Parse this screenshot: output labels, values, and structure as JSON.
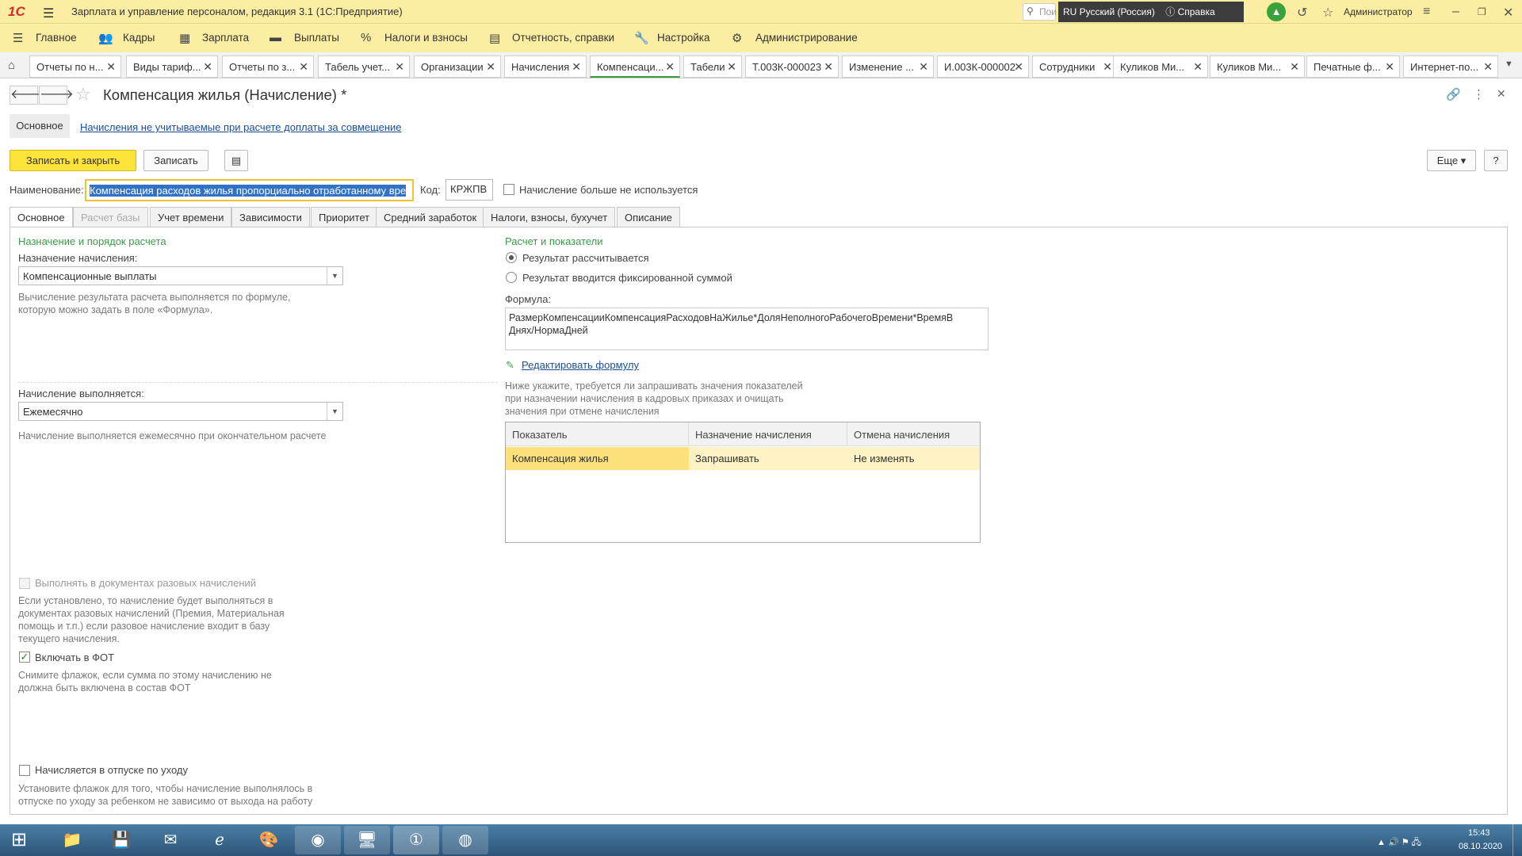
{
  "titlebar": {
    "logo": "1С",
    "title": "Зарплата и управление персоналом, редакция 3.1  (1С:Предприятие)",
    "search_placeholder": "Пои",
    "language": "RU Русский (Россия)",
    "help": "Справка",
    "user": "Администратор"
  },
  "main_menu": [
    {
      "label": "Главное",
      "icon": "menu-icon"
    },
    {
      "label": "Кадры",
      "icon": "people-icon"
    },
    {
      "label": "Зарплата",
      "icon": "calculator-icon"
    },
    {
      "label": "Выплаты",
      "icon": "wallet-icon"
    },
    {
      "label": "Налоги и взносы",
      "icon": "percent-icon"
    },
    {
      "label": "Отчетность, справки",
      "icon": "report-icon"
    },
    {
      "label": "Настройка",
      "icon": "wrench-icon"
    },
    {
      "label": "Администрирование",
      "icon": "gear-icon"
    }
  ],
  "window_tabs": [
    {
      "label": "Отчеты по н..."
    },
    {
      "label": "Виды тариф..."
    },
    {
      "label": "Отчеты по з..."
    },
    {
      "label": "Табель учет..."
    },
    {
      "label": "Организации"
    },
    {
      "label": "Начисления"
    },
    {
      "label": "Компенсаци..."
    },
    {
      "label": "Табели"
    },
    {
      "label": "Т.003К-000023"
    },
    {
      "label": "Изменение ..."
    },
    {
      "label": "И.003К-000002"
    },
    {
      "label": "Сотрудники"
    },
    {
      "label": "Куликов Ми..."
    },
    {
      "label": "Куликов Ми..."
    },
    {
      "label": "Печатные ф..."
    },
    {
      "label": "Интернет-по..."
    }
  ],
  "form": {
    "title": "Компенсация жилья (Начисление) *",
    "nav_main": "Основное",
    "nav_link": "Начисления не учитываемые при расчете доплаты за совмещение",
    "btn_save_close": "Записать и закрыть",
    "btn_save": "Записать",
    "btn_more": "Еще",
    "btn_help": "?",
    "name_label": "Наименование:",
    "name_value": "Компенсация расходов жилья пропорциально отработанному вре",
    "code_label": "Код:",
    "code_value": "КРЖПВ",
    "not_used_label": "Начисление больше не используется",
    "tabs": [
      "Основное",
      "Расчет базы",
      "Учет времени",
      "Зависимости",
      "Приоритет",
      "Средний заработок",
      "Налоги, взносы, бухучет",
      "Описание"
    ]
  },
  "left": {
    "section_title": "Назначение и порядок расчета",
    "purpose_label": "Назначение начисления:",
    "purpose_value": "Компенсационные выплаты",
    "purpose_hint1": "Вычисление результата расчета выполняется по формуле,",
    "purpose_hint2": "которую можно задать в поле «Формула».",
    "period_label": "Начисление выполняется:",
    "period_value": "Ежемесячно",
    "period_hint": "Начисление выполняется ежемесячно при окончательном расчете",
    "onetime_label": "Выполнять в документах разовых начислений",
    "onetime_hint": [
      "Если установлено, то начисление будет выполняться в",
      "документах разовых начислений (Премия, Материальная",
      "помощь и т.п.) если разовое начисление входит в базу",
      "текущего начисления."
    ],
    "fot_label": "Включать в ФОТ",
    "fot_hint": [
      "Снимите флажок, если сумма по этому начислению не",
      "должна быть включена в состав ФОТ"
    ],
    "leave_label": "Начисляется в отпуске по уходу",
    "leave_hint": [
      "Установите флажок для того, чтобы начисление выполнялось в",
      "отпуске по уходу за ребенком не зависимо от выхода на работу"
    ]
  },
  "right": {
    "section_title": "Расчет и показатели",
    "radio_calc": "Результат рассчитывается",
    "radio_fixed": "Результат вводится фиксированной суммой",
    "formula_label": "Формула:",
    "formula_line1": "РазмерКомпенсацииКомпенсацияРасходовНаЖилье*ДоляНеполногоРабочегоВремени*ВремяВ",
    "formula_line2": "Днях/НормаДней",
    "edit_formula": "Редактировать формулу",
    "ind_hint": [
      "Ниже укажите, требуется ли запрашивать значения показателей",
      "при назначении начисления в кадровых приказах и очищать",
      "значения при отмене начисления"
    ],
    "table_headers": [
      "Показатель",
      "Назначение начисления",
      "Отмена начисления"
    ],
    "table_rows": [
      [
        "Компенсация жилья",
        "Запрашивать",
        "Не изменять"
      ]
    ]
  },
  "taskbar": {
    "time": "15:43",
    "date": "08.10.2020"
  }
}
